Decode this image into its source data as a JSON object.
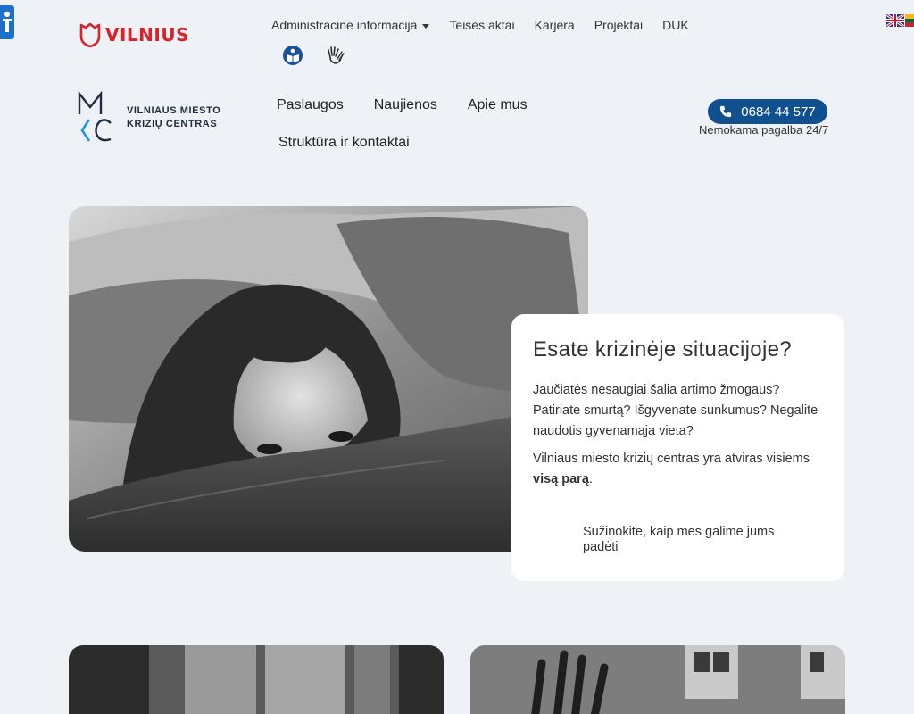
{
  "header": {
    "city_logo_text": "VILNIUS",
    "top_nav": [
      {
        "label": "Administracinė informacija",
        "has_dropdown": true
      },
      {
        "label": "Teisės aktai"
      },
      {
        "label": "Karjera"
      },
      {
        "label": "Projektai"
      },
      {
        "label": "DUK"
      }
    ],
    "top_icons": [
      "easy-read-icon",
      "sign-language-icon"
    ],
    "languages": [
      "en-flag-icon",
      "lt-flag-icon"
    ]
  },
  "brand": {
    "name_line1": "VILNIAUS MIESTO",
    "name_line2": "KRIZIŲ CENTRAS"
  },
  "main_nav": [
    {
      "label": "Paslaugos"
    },
    {
      "label": "Naujienos"
    },
    {
      "label": "Apie mus"
    },
    {
      "label": "Struktūra ir kontaktai"
    }
  ],
  "phone": {
    "number": "0684 44 577",
    "subtitle": "Nemokama pagalba 24/7"
  },
  "hero": {
    "title": "Esate krizinėje situacijoje?",
    "paragraph1": "Jaučiatės nesaugiai šalia artimo žmogaus? Patiriate smurtą? Išgyvenate sunkumus? Negalite naudotis gyvenamąja vieta?",
    "paragraph2_prefix": "Vilniaus miesto krizių centras yra atviras visiems ",
    "paragraph2_bold": "visą parą",
    "paragraph2_suffix": ".",
    "cta": "Sužinokite, kaip mes galime jums padėti"
  },
  "colors": {
    "background": "#eef1f5",
    "primary": "#10508f",
    "city_red": "#d8232a",
    "logo_blue": "#2196e8"
  }
}
